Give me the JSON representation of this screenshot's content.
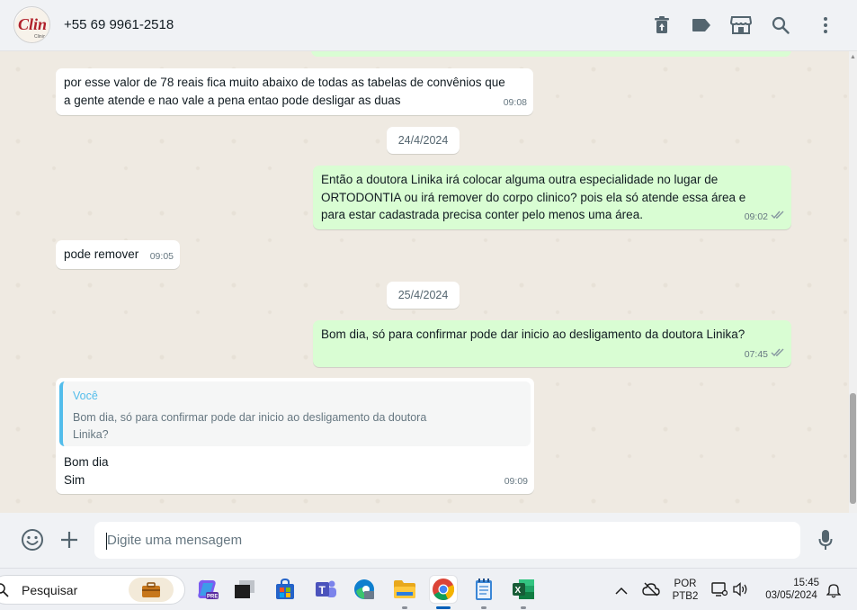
{
  "header": {
    "contact_name": "+55 69 9961-2518",
    "avatar_logo_text": "Clin",
    "avatar_logo_sub": "Clinic"
  },
  "messages": [
    {
      "direction": "in",
      "text": "por esse valor de 78 reais fica muito abaixo de todas as tabelas de convênios que\na gente atende e nao vale a pena entao pode desligar as duas",
      "time": "09:08"
    },
    {
      "type": "date",
      "label": "24/4/2024"
    },
    {
      "direction": "out",
      "text": "Então a doutora Linika irá colocar alguma outra especialidade no lugar de\nORTODONTIA ou irá remover do corpo clinico? pois ela só atende essa área e\npara estar cadastrada precisa conter pelo menos uma área.",
      "time": "09:02",
      "status": "read"
    },
    {
      "direction": "in",
      "text": "pode remover",
      "time": "09:05"
    },
    {
      "type": "date",
      "label": "25/4/2024"
    },
    {
      "direction": "out",
      "text": "Bom dia, só para confirmar pode dar inicio ao desligamento da doutora Linika?",
      "time": "07:45",
      "status": "read"
    },
    {
      "direction": "in",
      "quote": {
        "author": "Você",
        "text": "Bom dia, só para confirmar pode dar inicio ao desligamento da doutora\nLinika?"
      },
      "text": "Bom dia\nSim",
      "time": "09:09"
    }
  ],
  "composer": {
    "placeholder": "Digite uma mensagem"
  },
  "taskbar": {
    "search_label": "Pesquisar",
    "copilot_badge": "PRE",
    "language": "POR",
    "layout": "PTB2",
    "time": "15:45",
    "date": "03/05/2024"
  },
  "colors": {
    "incoming": "#ffffff",
    "outgoing": "#d9fdd3",
    "quote_accent": "#53bdeb",
    "chat_background": "#efeae2"
  }
}
